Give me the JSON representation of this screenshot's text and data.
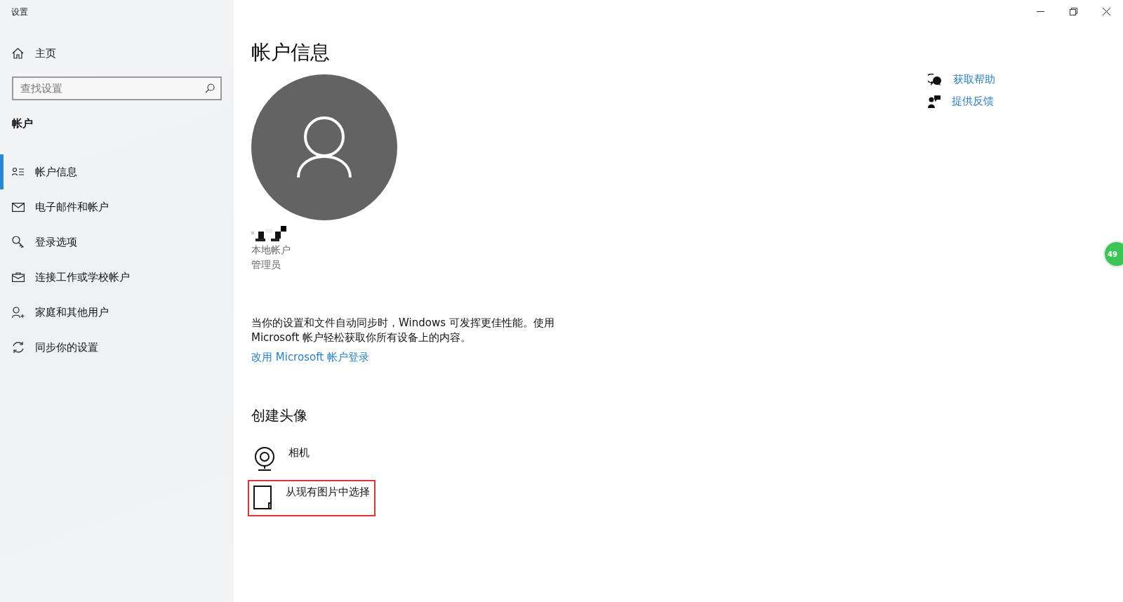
{
  "window": {
    "title": "设置"
  },
  "sidebar": {
    "home": "主页",
    "search": {
      "placeholder": "查找设置"
    },
    "section": "帐户",
    "items": [
      {
        "label": "帐户信息",
        "kind": "info",
        "selected": true
      },
      {
        "label": "电子邮件和帐户",
        "kind": "mail",
        "selected": false
      },
      {
        "label": "登录选项",
        "kind": "key",
        "selected": false
      },
      {
        "label": "连接工作或学校帐户",
        "kind": "work",
        "selected": false
      },
      {
        "label": "家庭和其他用户",
        "kind": "family",
        "selected": false
      },
      {
        "label": "同步你的设置",
        "kind": "sync",
        "selected": false
      }
    ]
  },
  "main": {
    "title": "帐户信息",
    "account_type": "本地帐户",
    "role": "管理员",
    "description": "当你的设置和文件自动同步时，Windows 可发挥更佳性能。使用 Microsoft 帐户轻松获取你所有设备上的内容。",
    "link": "改用 Microsoft 帐户登录",
    "avatar_heading": "创建头像",
    "avatar_options": [
      {
        "label": "相机",
        "kind": "camera",
        "highlighted": false
      },
      {
        "label": "从现有图片中选择",
        "kind": "browse",
        "highlighted": true
      }
    ]
  },
  "help_links": [
    {
      "label": "获取帮助",
      "kind": "help"
    },
    {
      "label": "提供反馈",
      "kind": "feedback"
    }
  ],
  "floating_badge": "49"
}
